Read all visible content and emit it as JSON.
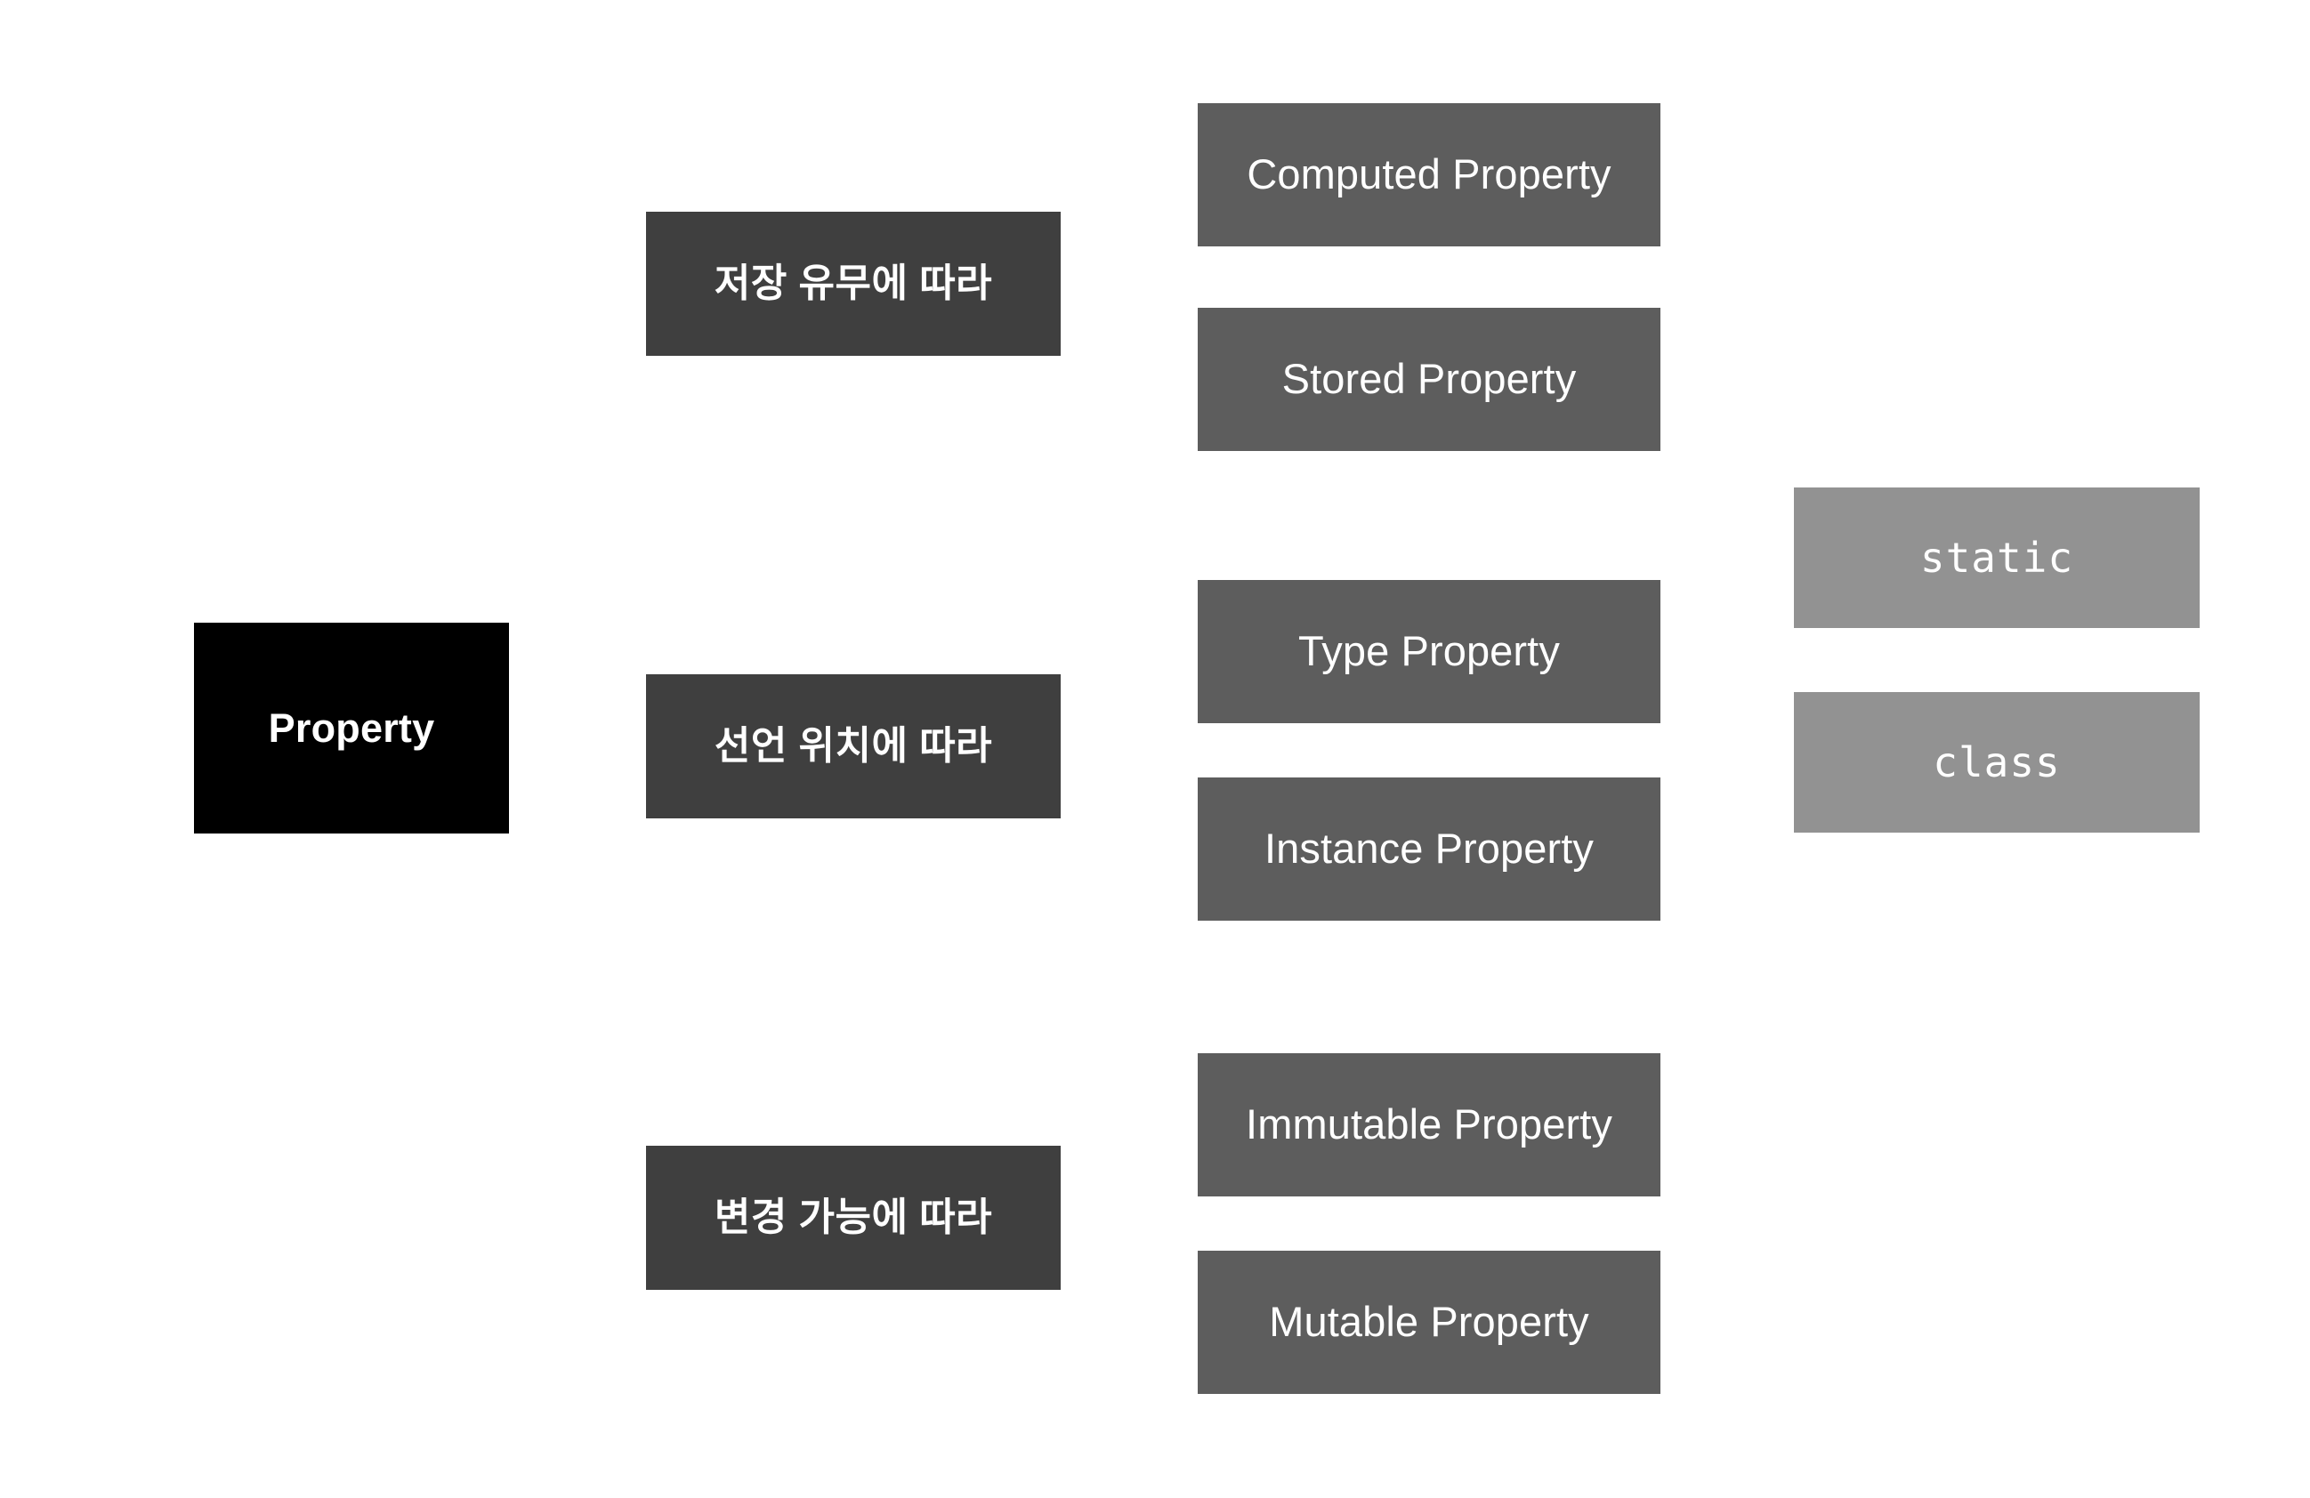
{
  "diagram": {
    "title": "Property",
    "background_color": "#ffffff",
    "colors": {
      "root": "#000000",
      "criteria": "#3f3f3f",
      "kind": "#5d5d5d",
      "keyword": "#929292",
      "text": "#ffffff"
    },
    "root": {
      "label": "Property"
    },
    "criteria": [
      {
        "label": "저장 유무에 따라"
      },
      {
        "label": "선언 위치에 따라"
      },
      {
        "label": "변경 가능에 따라"
      }
    ],
    "kinds": [
      {
        "label": "Computed Property"
      },
      {
        "label": "Stored Property"
      },
      {
        "label": "Type Property"
      },
      {
        "label": "Instance Property"
      },
      {
        "label": "Immutable Property"
      },
      {
        "label": "Mutable Property"
      }
    ],
    "keywords": [
      {
        "label": "static"
      },
      {
        "label": "class"
      }
    ]
  }
}
